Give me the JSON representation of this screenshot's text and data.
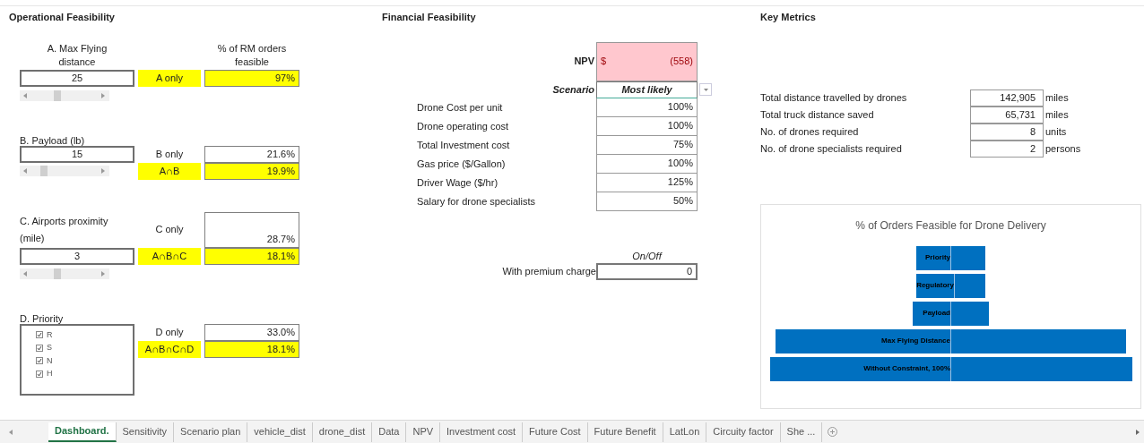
{
  "operational": {
    "title": "Operational Feasibility",
    "result_header": "% of RM orders feasible",
    "constraints": [
      {
        "kind": "slider",
        "label": "A. Max Flying distance",
        "value": "25",
        "rows": [
          {
            "label": "A only",
            "value": "97%",
            "highlight": true
          }
        ]
      },
      {
        "kind": "slider",
        "label": "B. Payload (lb)",
        "value": "15",
        "rows": [
          {
            "label": "B only",
            "value": "21.6%",
            "highlight": false
          },
          {
            "label": "A∩B",
            "value": "19.9%",
            "highlight": true
          }
        ]
      },
      {
        "kind": "slider",
        "label": "C. Airports proximity (mile)",
        "value": "3",
        "rows": [
          {
            "label": "C only",
            "value": "28.7%",
            "highlight": false
          },
          {
            "label": "A∩B∩C",
            "value": "18.1%",
            "highlight": true
          }
        ]
      },
      {
        "kind": "list",
        "label": "D. Priority",
        "options": [
          {
            "label": "R",
            "checked": true
          },
          {
            "label": "S",
            "checked": true
          },
          {
            "label": "N",
            "checked": true
          },
          {
            "label": "H",
            "checked": true
          }
        ],
        "rows": [
          {
            "label": "D only",
            "value": "33.0%",
            "highlight": false
          },
          {
            "label": "A∩B∩C∩D",
            "value": "18.1%",
            "highlight": true
          }
        ]
      }
    ]
  },
  "financial": {
    "title": "Financial Feasibility",
    "npv": {
      "label": "NPV",
      "currency": "$",
      "value": "(558)"
    },
    "scenario": {
      "label": "Scenario",
      "value": "Most likely"
    },
    "factors": [
      {
        "label": "Drone Cost per unit",
        "value": "100%"
      },
      {
        "label": "Drone operating cost",
        "value": "100%"
      },
      {
        "label": "Total Investment cost",
        "value": "75%"
      },
      {
        "label": "Gas price ($/Gallon)",
        "value": "100%"
      },
      {
        "label": "Driver Wage ($/hr)",
        "value": "125%"
      },
      {
        "label": "Salary for drone specialists",
        "value": "50%"
      }
    ],
    "premium": {
      "header": "On/Off",
      "label": "With premium charge",
      "value": "0"
    }
  },
  "key_metrics": {
    "title": "Key Metrics",
    "rows": [
      {
        "label": "Total distance travelled by drones",
        "value": "142,905",
        "unit": "miles"
      },
      {
        "label": "Total truck distance saved",
        "value": "65,731",
        "unit": "miles"
      },
      {
        "label": "No. of drones required",
        "value": "8",
        "unit": "units"
      },
      {
        "label": "No. of drone specialists required",
        "value": "2",
        "unit": "persons"
      }
    ]
  },
  "chart": {
    "title": "% of Orders Feasible for Drone Delivery",
    "categories": [
      "Priority",
      "Regulatory",
      "Payload",
      "Max Flying Distance",
      "Without Constraint, 100%"
    ]
  },
  "sheet_tabs": [
    {
      "label": "Dashboard.",
      "selected": true
    },
    {
      "label": "Sensitivity",
      "selected": false
    },
    {
      "label": "Scenario plan",
      "selected": false
    },
    {
      "label": "vehicle_dist",
      "selected": false
    },
    {
      "label": "drone_dist",
      "selected": false
    },
    {
      "label": "Data",
      "selected": false
    },
    {
      "label": "NPV",
      "selected": false
    },
    {
      "label": "Investment cost",
      "selected": false
    },
    {
      "label": "Future Cost",
      "selected": false
    },
    {
      "label": "Future Benefit",
      "selected": false
    },
    {
      "label": "LatLon",
      "selected": false
    },
    {
      "label": "Circuity factor",
      "selected": false
    },
    {
      "label": "She ...",
      "selected": false
    }
  ]
}
